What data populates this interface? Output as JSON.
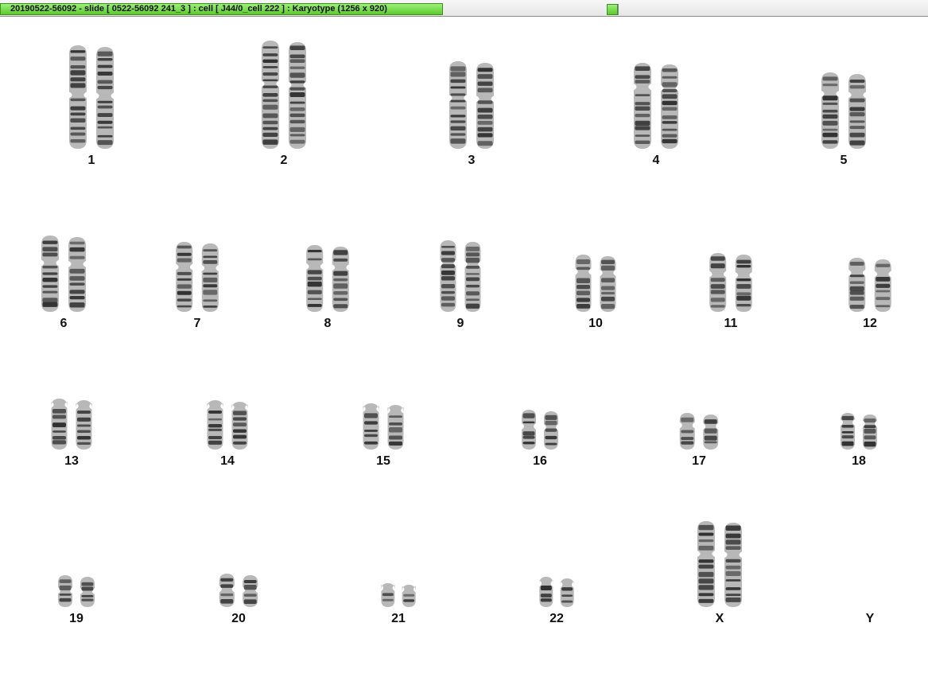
{
  "window": {
    "title": "20190522-56092 - slide [ 0522-56092 241_3 ] : cell [ J44/0_cell 222 ] : Karyotype  (1256 x 920)"
  },
  "karyotype": {
    "chromosomes": [
      {
        "label": "1"
      },
      {
        "label": "2"
      },
      {
        "label": "3"
      },
      {
        "label": "4"
      },
      {
        "label": "5"
      },
      {
        "label": "6"
      },
      {
        "label": "7"
      },
      {
        "label": "8"
      },
      {
        "label": "9"
      },
      {
        "label": "10"
      },
      {
        "label": "11"
      },
      {
        "label": "12"
      },
      {
        "label": "13"
      },
      {
        "label": "14"
      },
      {
        "label": "15"
      },
      {
        "label": "16"
      },
      {
        "label": "17"
      },
      {
        "label": "18"
      },
      {
        "label": "19"
      },
      {
        "label": "20"
      },
      {
        "label": "21"
      },
      {
        "label": "22"
      },
      {
        "label": "X"
      },
      {
        "label": "Y"
      }
    ]
  },
  "colors": {
    "tab_green": "#5ec92e",
    "chromatid_dark": "#2a2a2a",
    "chromatid_light": "#b0b0b0"
  }
}
